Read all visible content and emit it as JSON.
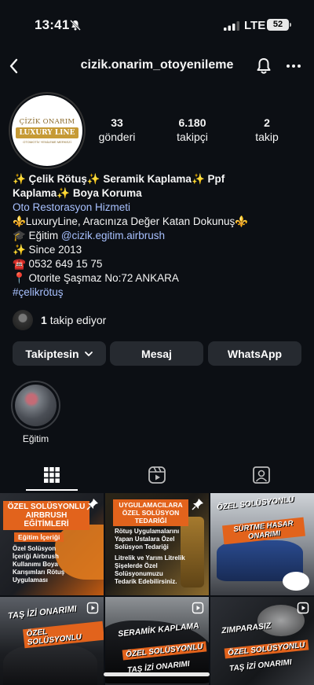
{
  "status_bar": {
    "time": "13:41",
    "network": "LTE",
    "battery": "52"
  },
  "profile": {
    "username": "cizik.onarim_otoyenileme",
    "logo": {
      "top": "ÇİZİK ONARIM",
      "mid": "LUXURY LINE",
      "bottom": "OTOMOTİV YENİLEME MERKEZİ"
    },
    "stats": [
      {
        "value": "33",
        "label": "gönderi"
      },
      {
        "value": "6.180",
        "label": "takipçi"
      },
      {
        "value": "2",
        "label": "takip"
      }
    ]
  },
  "bio": {
    "title_line1": "✨ Çelik Rötuş✨ Seramik Kaplama✨ Ppf",
    "title_line2": "Kaplama✨ Boya Koruma",
    "category": "Oto Restorasyon Hizmeti",
    "line_luxury": "⚜️LuxuryLine, Aracınıza Değer Katan Dokunuş⚜️",
    "line_egitim_prefix": "🎓 Eğitim ",
    "line_egitim_mention": "@cizik.egitim.airbrush",
    "line_since": "✨ Since 2013",
    "line_phone": "☎️ 0532 649 15 75",
    "line_address": "📍 Otorite Şaşmaz No:72 ANKARA",
    "hashtag": "#çelikrötuş"
  },
  "followers": {
    "count": "1",
    "text": "takip ediyor"
  },
  "buttons": {
    "following": "Takiptesin",
    "message": "Mesaj",
    "whatsapp": "WhatsApp"
  },
  "highlights": [
    {
      "label": "Eğitim"
    }
  ],
  "posts": [
    {
      "ribbon": "ÖZEL SOLÜSYONLU AIRBRUSH EĞİTİMLERİ",
      "sub": "Eğitim İçeriği",
      "body": "Özel Solüsyon İçeriği Airbrush Kullanımı Boya Karışımları Rötuş Uygulaması"
    },
    {
      "ribbon": "UYGULAMACILARA ÖZEL SOLÜSYON TEDARİĞİ",
      "body1": "Rötuş Uygulamalarını Yapan Ustalara Özel Solüsyon Tedariği",
      "body2": "Litrelik ve Yarım Litrelik Şişelerde Özel Solüsyonumuzu Tedarik Edebilirsiniz."
    },
    {
      "cap1": "ÖZEL SOLÜSYONLU",
      "cap2": "SÜRTME HASAR ONARIMI"
    },
    {
      "cap1": "TAŞ İZİ ONARIMI",
      "cap2": "ÖZEL SOLÜSYONLU"
    },
    {
      "cap1": "SERAMİK KAPLAMA",
      "cap2": "ÖZEL SOLÜSYONLU",
      "cap3": "TAŞ İZİ ONARIMI"
    },
    {
      "cap1": "ZIMPARASIZ",
      "cap2": "ÖZEL SOLÜSYONLU",
      "cap3": "TAŞ İZİ ONARIMI"
    }
  ],
  "colors": {
    "background": "#0c0f14",
    "button": "#262a30",
    "link": "#a8c1ff",
    "accent_orange": "#e2631c"
  }
}
